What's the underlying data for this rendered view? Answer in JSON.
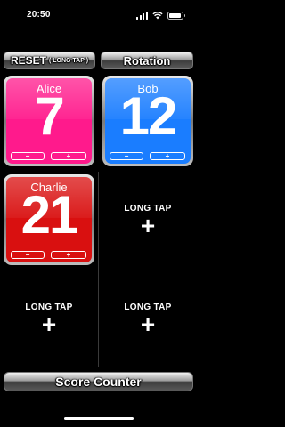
{
  "status": {
    "time": "20:50"
  },
  "toolbar": {
    "reset_label": "RESET",
    "reset_hint": "( LONG TAP )",
    "rotation_label": "Rotation"
  },
  "players": [
    {
      "name": "Alice",
      "score": "7",
      "color": "#ff1a8c"
    },
    {
      "name": "Bob",
      "score": "12",
      "color": "#1a7dff"
    },
    {
      "name": "Charlie",
      "score": "21",
      "color": "#d91010"
    }
  ],
  "controls": {
    "minus": "−",
    "plus": "+"
  },
  "empty_slot": {
    "label": "LONG TAP",
    "plus": "+"
  },
  "footer": {
    "title": "Score Counter"
  }
}
